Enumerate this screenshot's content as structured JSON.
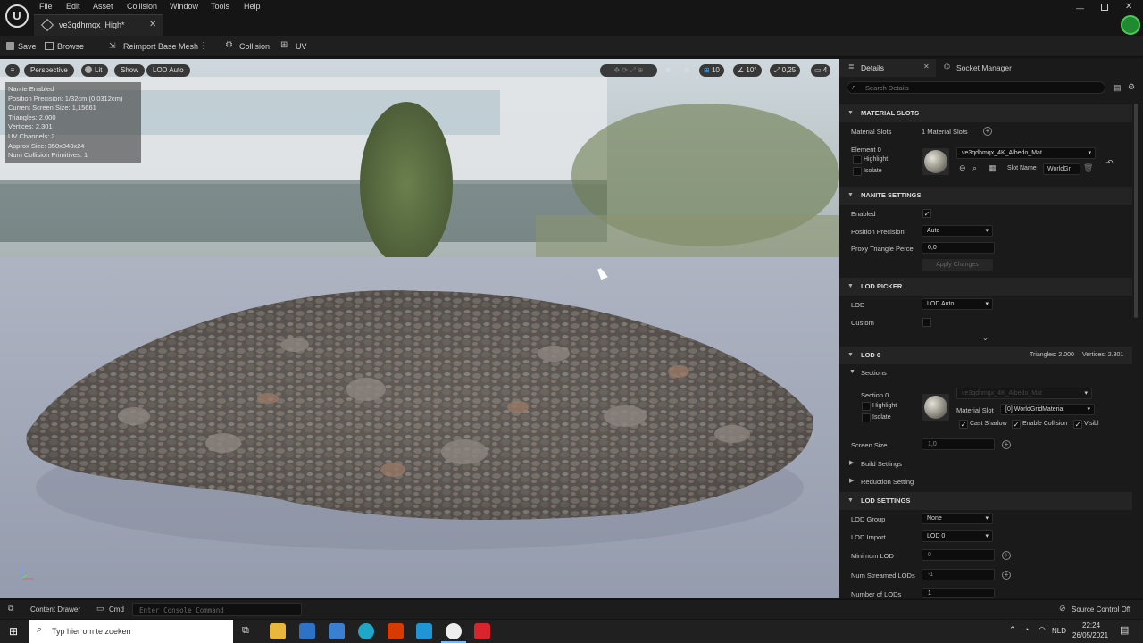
{
  "window": {
    "tab_title": "ve3qdhmqx_High*",
    "menu": [
      "File",
      "Edit",
      "Asset",
      "Collision",
      "Window",
      "Tools",
      "Help"
    ]
  },
  "toolbar": {
    "save_label": "Save",
    "browse_label": "Browse",
    "reimport_label": "Reimport Base Mesh",
    "collision_label": "Collision",
    "uv_label": "UV"
  },
  "viewport": {
    "perspective_label": "Perspective",
    "lit_label": "Lit",
    "show_label": "Show",
    "lod_label": "LOD Auto",
    "grid_value": "10",
    "angle_value": "10°",
    "scale_value": "0,25",
    "camera_value": "4",
    "stats": [
      "Nanite Enabled",
      "Position Precision: 1/32cm (0.0312cm)",
      "Current Screen Size: 1,15661",
      "Triangles: 2.000",
      "Vertices: 2.301",
      "UV Channels: 2",
      "Approx Size: 350x343x24",
      "Num Collision Primitives: 1"
    ]
  },
  "details": {
    "tab_label": "Details",
    "socket_tab_label": "Socket Manager",
    "search_placeholder": "Search Details",
    "material_slots": {
      "header": "MATERIAL SLOTS",
      "label": "Material Slots",
      "count": "1 Material Slots",
      "element_label": "Element 0",
      "highlight": "Highlight",
      "isolate": "Isolate",
      "material": "ve3qdhmqx_4K_Albedo_Mat",
      "slot_name_label": "Slot Name",
      "slot_name_value": "WorldGr"
    },
    "nanite": {
      "header": "NANITE SETTINGS",
      "enabled_label": "Enabled",
      "precision_label": "Position Precision",
      "precision_value": "Auto",
      "proxy_label": "Proxy Triangle Perce",
      "proxy_value": "0,0",
      "apply_label": "Apply Changes"
    },
    "lod_picker": {
      "header": "LOD PICKER",
      "lod_label": "LOD",
      "lod_value": "LOD Auto",
      "custom_label": "Custom"
    },
    "lod0": {
      "header": "LOD 0",
      "triangles": "Triangles: 2.000",
      "vertices": "Vertices: 2.301",
      "sections_label": "Sections",
      "section_label": "Section 0",
      "highlight": "Highlight",
      "isolate": "Isolate",
      "material_ghost": "ve3qdhmqx_4K_Albedo_Mat",
      "material_slot_label": "Material Slot",
      "material_slot_value": "[0] WorldGridMaterial",
      "cast_shadow": "Cast Shadow",
      "enable_collision": "Enable Collision",
      "visible": "Visibl",
      "screen_size_label": "Screen Size",
      "screen_size_value": "1,0",
      "build_settings": "Build Settings",
      "reduction_settings": "Reduction Setting"
    },
    "lod_settings": {
      "header": "LOD SETTINGS",
      "group_label": "LOD Group",
      "group_value": "None",
      "import_label": "LOD Import",
      "import_value": "LOD 0",
      "min_lod_label": "Minimum LOD",
      "min_lod_value": "0",
      "streamed_label": "Num Streamed LODs",
      "streamed_value": "-1",
      "num_lods_label": "Number of LODs",
      "num_lods_value": "1"
    }
  },
  "statusbar": {
    "content_drawer": "Content Drawer",
    "cmd": "Cmd",
    "console_placeholder": "Enter Console Command",
    "source_control": "Source Control Off"
  },
  "taskbar": {
    "search_placeholder": "Typ hier om te zoeken",
    "language": "NLD",
    "time": "22:24",
    "date": "26/05/2021"
  }
}
